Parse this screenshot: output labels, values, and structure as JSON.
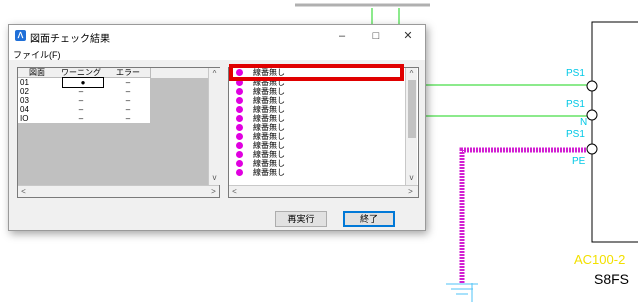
{
  "drawing": {
    "labels": [
      "PS1",
      "PS1",
      "N",
      "PS1",
      "PE"
    ],
    "power_label": "AC100-2",
    "device_label": "S8FS"
  },
  "dialog": {
    "title": "図面チェック結果",
    "minimize": "–",
    "maximize": "□",
    "close": "✕",
    "menu": {
      "file": "ファイル(F)"
    },
    "left_grid": {
      "columns": [
        "図面",
        "ワーニング",
        "エラー"
      ],
      "rows": [
        {
          "drawing": "01",
          "warning": "●",
          "error": "–"
        },
        {
          "drawing": "02",
          "warning": "–",
          "error": "–"
        },
        {
          "drawing": "03",
          "warning": "–",
          "error": "–"
        },
        {
          "drawing": "04",
          "warning": "–",
          "error": "–"
        },
        {
          "drawing": "IO",
          "warning": "–",
          "error": "–"
        }
      ]
    },
    "right_list": {
      "items": [
        "線番無し",
        "線番無し",
        "線番無し",
        "線番無し",
        "線番無し",
        "線番無し",
        "線番無し",
        "線番無し",
        "線番無し",
        "線番無し",
        "線番無し",
        "線番無し"
      ]
    },
    "buttons": {
      "rerun": "再実行",
      "close": "終了"
    },
    "colors": {
      "dot": "#e000e0",
      "highlight": "#e00000",
      "wire_green": "#19d419",
      "wire_magenta": "#d21fd2",
      "label_cyan": "#00c8e6",
      "label_yellow": "#f2e000"
    }
  }
}
